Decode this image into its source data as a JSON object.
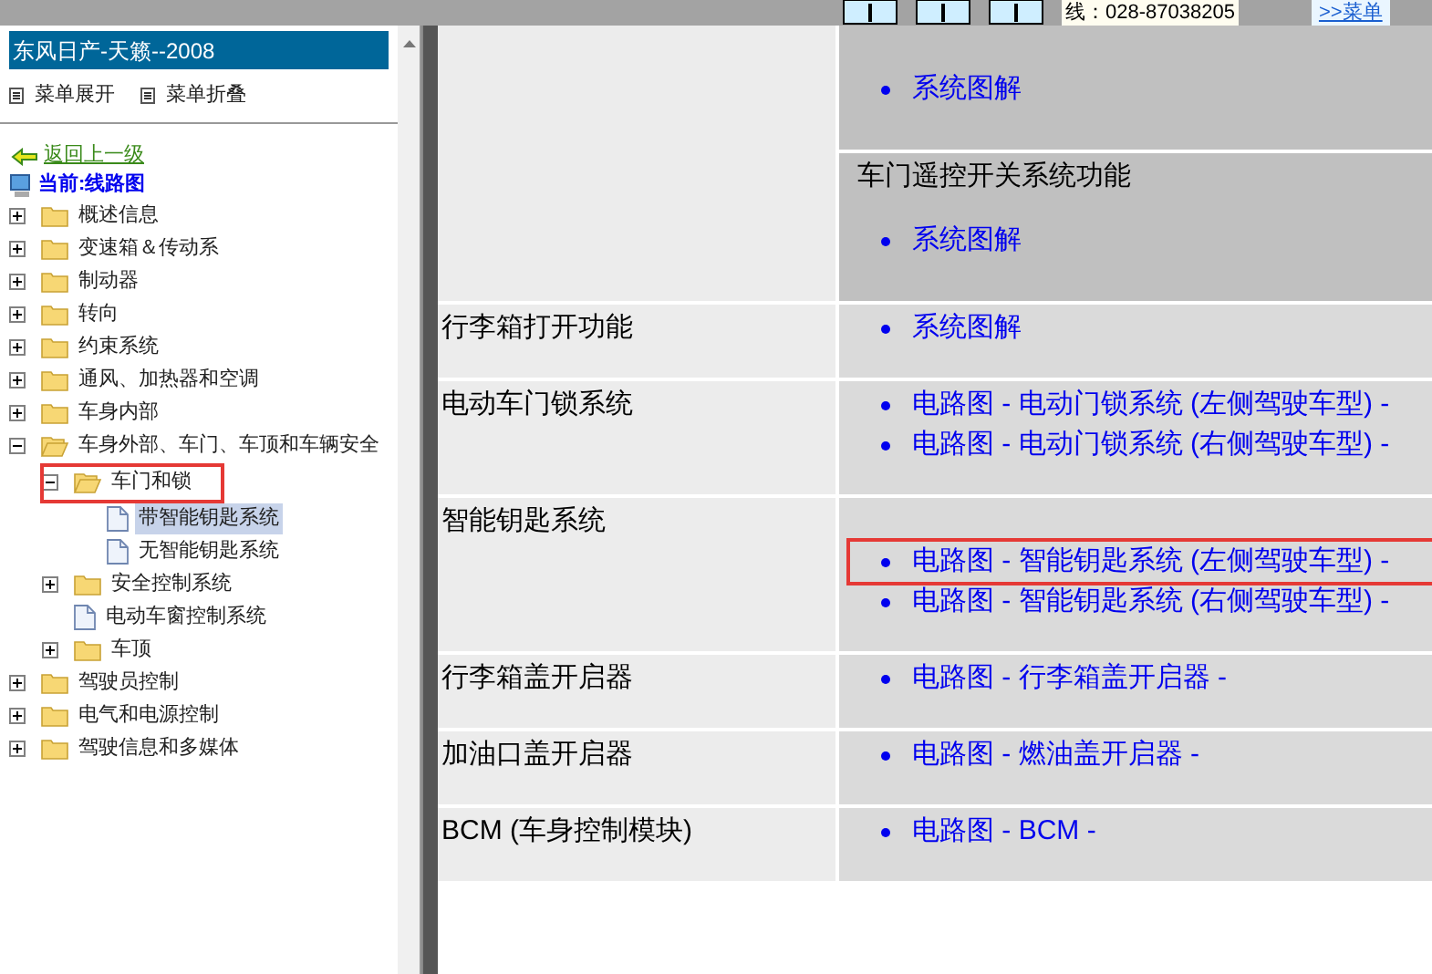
{
  "top_bar": {
    "phone": "线：028-87038205",
    "menu_link": ">>菜单"
  },
  "sidebar": {
    "title": "东风日产-天籁--2008",
    "menu_actions": [
      "菜单展开",
      "菜单折叠"
    ],
    "back_link": "返回上一级",
    "current": "当前:线路图",
    "tree": [
      {
        "label": "概述信息",
        "expanded": false,
        "kind": "folder"
      },
      {
        "label": "变速箱＆传动系",
        "expanded": false,
        "kind": "folder"
      },
      {
        "label": "制动器",
        "expanded": false,
        "kind": "folder"
      },
      {
        "label": "转向",
        "expanded": false,
        "kind": "folder"
      },
      {
        "label": "约束系统",
        "expanded": false,
        "kind": "folder"
      },
      {
        "label": "通风、加热器和空调",
        "expanded": false,
        "kind": "folder"
      },
      {
        "label": "车身内部",
        "expanded": false,
        "kind": "folder"
      },
      {
        "label": "车身外部、车门、车顶和车辆安全",
        "expanded": true,
        "kind": "folder",
        "children": [
          {
            "label": "车门和锁",
            "expanded": true,
            "kind": "folder",
            "highlighted": true,
            "children": [
              {
                "label": "带智能钥匙系统",
                "kind": "page",
                "selected": true
              },
              {
                "label": "无智能钥匙系统",
                "kind": "page",
                "selected": false
              }
            ]
          },
          {
            "label": "安全控制系统",
            "expanded": false,
            "kind": "folder"
          },
          {
            "label": "电动车窗控制系统",
            "kind": "page",
            "selected": false
          },
          {
            "label": "车顶",
            "expanded": false,
            "kind": "folder"
          }
        ]
      },
      {
        "label": "驾驶员控制",
        "expanded": false,
        "kind": "folder"
      },
      {
        "label": "电气和电源控制",
        "expanded": false,
        "kind": "folder"
      },
      {
        "label": "驾驶信息和多媒体",
        "expanded": false,
        "kind": "folder"
      }
    ]
  },
  "table": {
    "rows": [
      {
        "sections": [
          {
            "links": [
              {
                "text": "系统图解",
                "highlighted": false
              }
            ]
          },
          {
            "title": "车门遥控开关系统功能",
            "links": [
              {
                "text": "系统图解",
                "highlighted": false
              }
            ]
          }
        ]
      },
      {
        "label": "行李箱打开功能",
        "sections": [
          {
            "links": [
              {
                "text": "系统图解",
                "highlighted": false
              }
            ]
          }
        ]
      },
      {
        "label": "电动车门锁系统",
        "sections": [
          {
            "links": [
              {
                "text": "电路图 - 电动门锁系统 (左侧驾驶车型) -",
                "highlighted": false
              },
              {
                "text": "电路图 - 电动门锁系统 (右侧驾驶车型) -",
                "highlighted": false
              }
            ]
          }
        ]
      },
      {
        "label": "智能钥匙系统",
        "sections": [
          {
            "links": [
              {
                "text": "电路图 - 智能钥匙系统 (左侧驾驶车型) -",
                "highlighted": true
              },
              {
                "text": "电路图 - 智能钥匙系统 (右侧驾驶车型) -",
                "highlighted": false
              }
            ]
          }
        ]
      },
      {
        "label": "行李箱盖开启器",
        "sections": [
          {
            "links": [
              {
                "text": "电路图 - 行李箱盖开启器 -",
                "highlighted": false
              }
            ]
          }
        ]
      },
      {
        "label": "加油口盖开启器",
        "sections": [
          {
            "links": [
              {
                "text": "电路图 - 燃油盖开启器 -",
                "highlighted": false
              }
            ]
          }
        ]
      },
      {
        "label": "BCM (车身控制模块)",
        "sections": [
          {
            "links": [
              {
                "text": "电路图 - BCM -",
                "highlighted": false
              }
            ]
          }
        ]
      }
    ]
  }
}
